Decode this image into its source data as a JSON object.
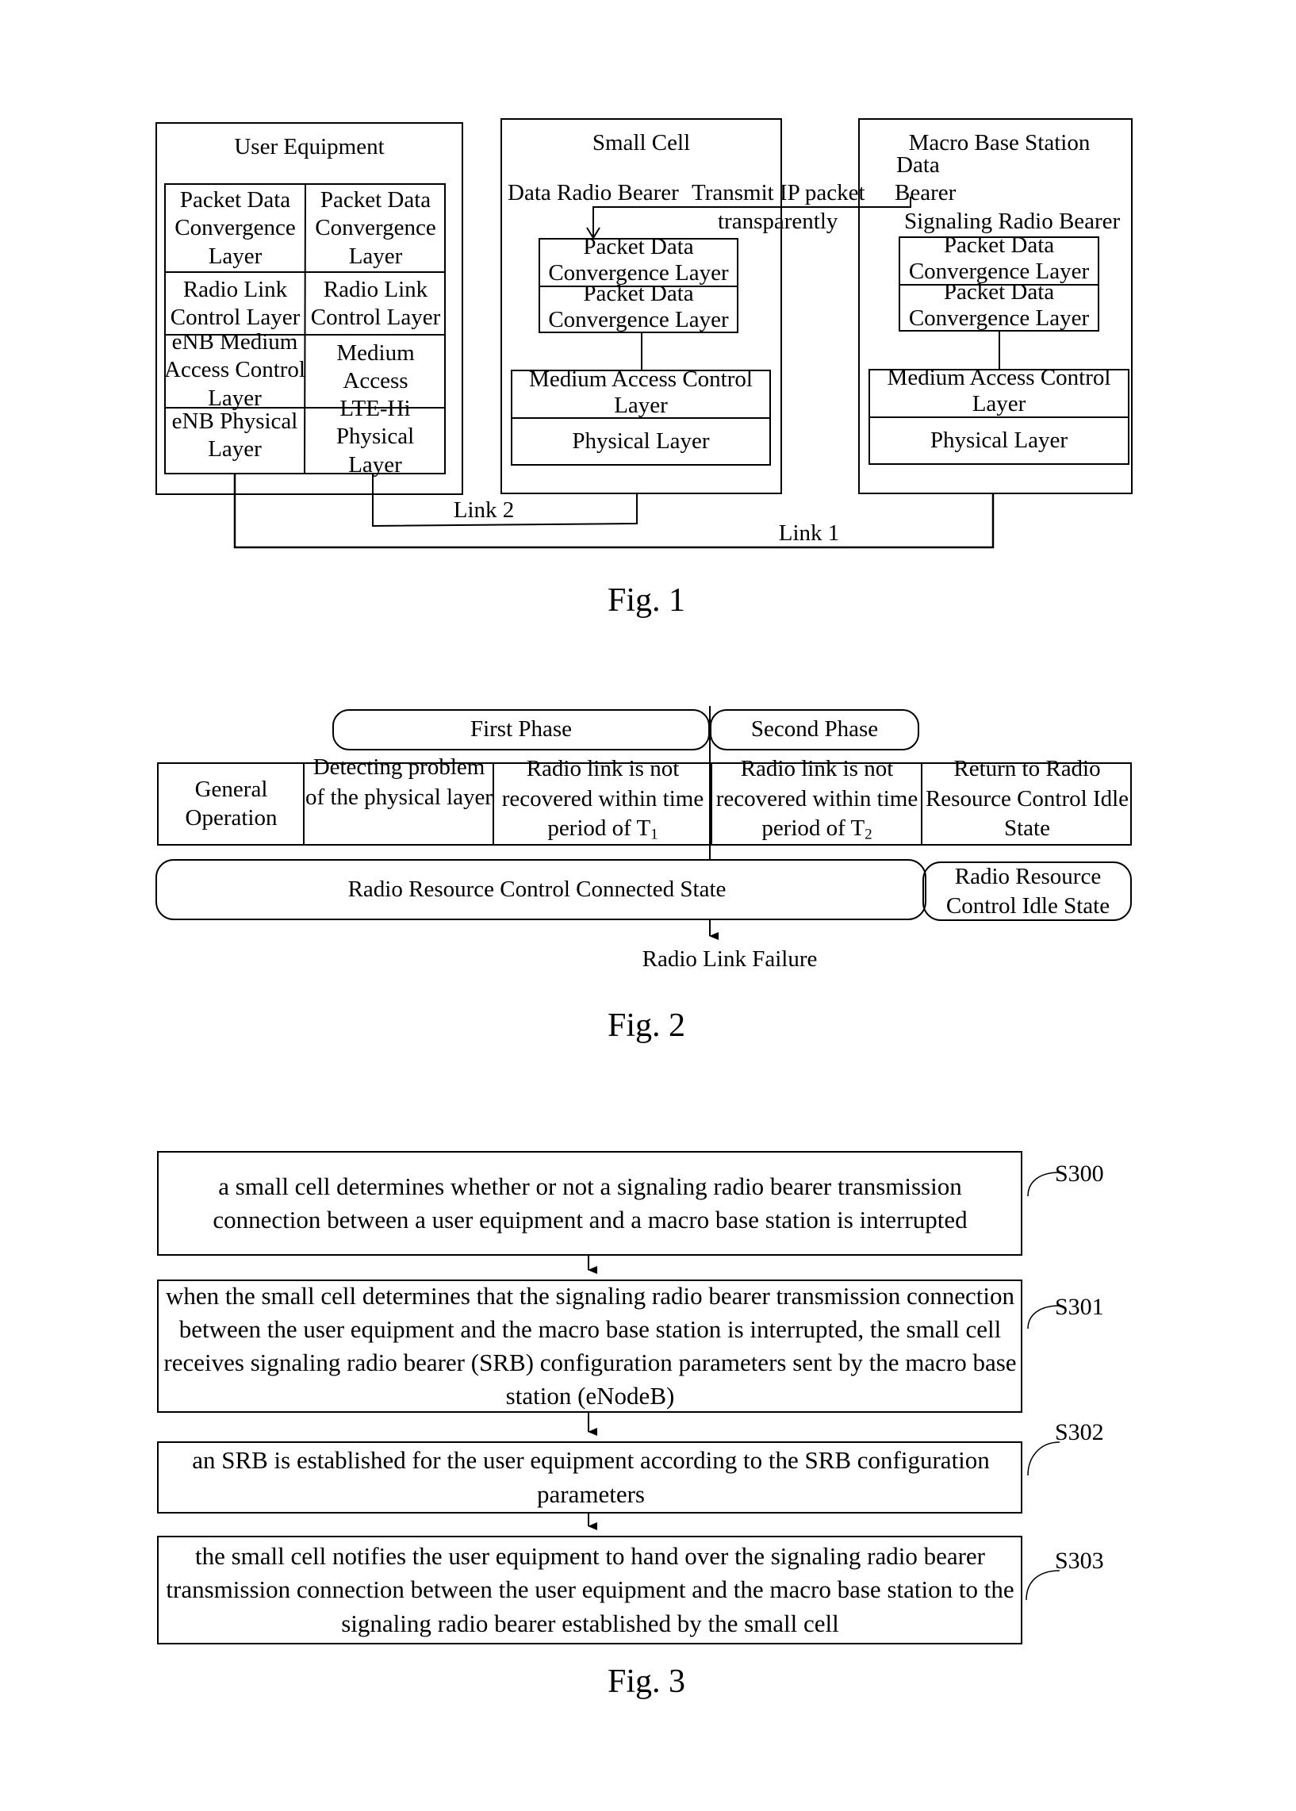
{
  "fig1": {
    "caption": "Fig. 1",
    "user_equipment": {
      "title": "User Equipment",
      "cells": [
        "Packet Data Convergence Layer",
        "Packet Data Convergence Layer",
        "Radio Link Control Layer",
        "Radio Link Control Layer",
        "eNB Medium Access Control Layer",
        "Medium Access",
        "eNB Physical Layer",
        "LTE-Hi Physical Layer"
      ]
    },
    "small_cell": {
      "title": "Small Cell",
      "drb_label": "Data Radio Bearer",
      "transmit_label_1": "Transmit IP packet",
      "transmit_label_2": "transparently",
      "pdcp_1": "Packet Data Convergence Layer",
      "pdcp_2": "Packet Data Convergence Layer",
      "mac": "Medium Access Control Layer",
      "phy": "Physical Layer"
    },
    "macro_base_station": {
      "title": "Macro Base Station",
      "data_bearer_1": "Data",
      "data_bearer_2": "Bearer",
      "srb_label": "Signaling Radio Bearer",
      "pdcp_1": "Packet Data Convergence Layer",
      "pdcp_2": "Packet Data Convergence Layer",
      "mac": "Medium Access Control Layer",
      "phy": "Physical Layer"
    },
    "link2": "Link 2",
    "link1": "Link 1"
  },
  "fig2": {
    "caption": "Fig. 2",
    "first_phase": "First Phase",
    "second_phase": "Second Phase",
    "columns": [
      "General Operation",
      "Detecting problem of the physical layer",
      "Radio link is not recovered within time period of T",
      "Radio link is not recovered within time period of T",
      "Return to Radio Resource Control Idle State"
    ],
    "t1_sub": "1",
    "t2_sub": "2",
    "connected_state": "Radio Resource Control Connected State",
    "idle_state": "Radio Resource Control Idle State",
    "rlf": "Radio Link Failure"
  },
  "fig3": {
    "caption": "Fig. 3",
    "steps": [
      {
        "id": "S300",
        "text": "a small cell determines whether or not a signaling radio bearer transmission connection between a user equipment and a macro base station is interrupted"
      },
      {
        "id": "S301",
        "text": "when the small cell determines that the signaling radio bearer transmission connection between the user equipment and the macro base station is interrupted, the small cell receives signaling radio bearer (SRB) configuration parameters sent by the macro base station (eNodeB)"
      },
      {
        "id": "S302",
        "text": "an SRB is established for the user equipment according to the SRB configuration parameters"
      },
      {
        "id": "S303",
        "text": "the small cell notifies the user equipment to hand over the signaling radio bearer transmission connection between the user equipment and the macro base station to the signaling radio bearer established by the small cell"
      }
    ]
  }
}
